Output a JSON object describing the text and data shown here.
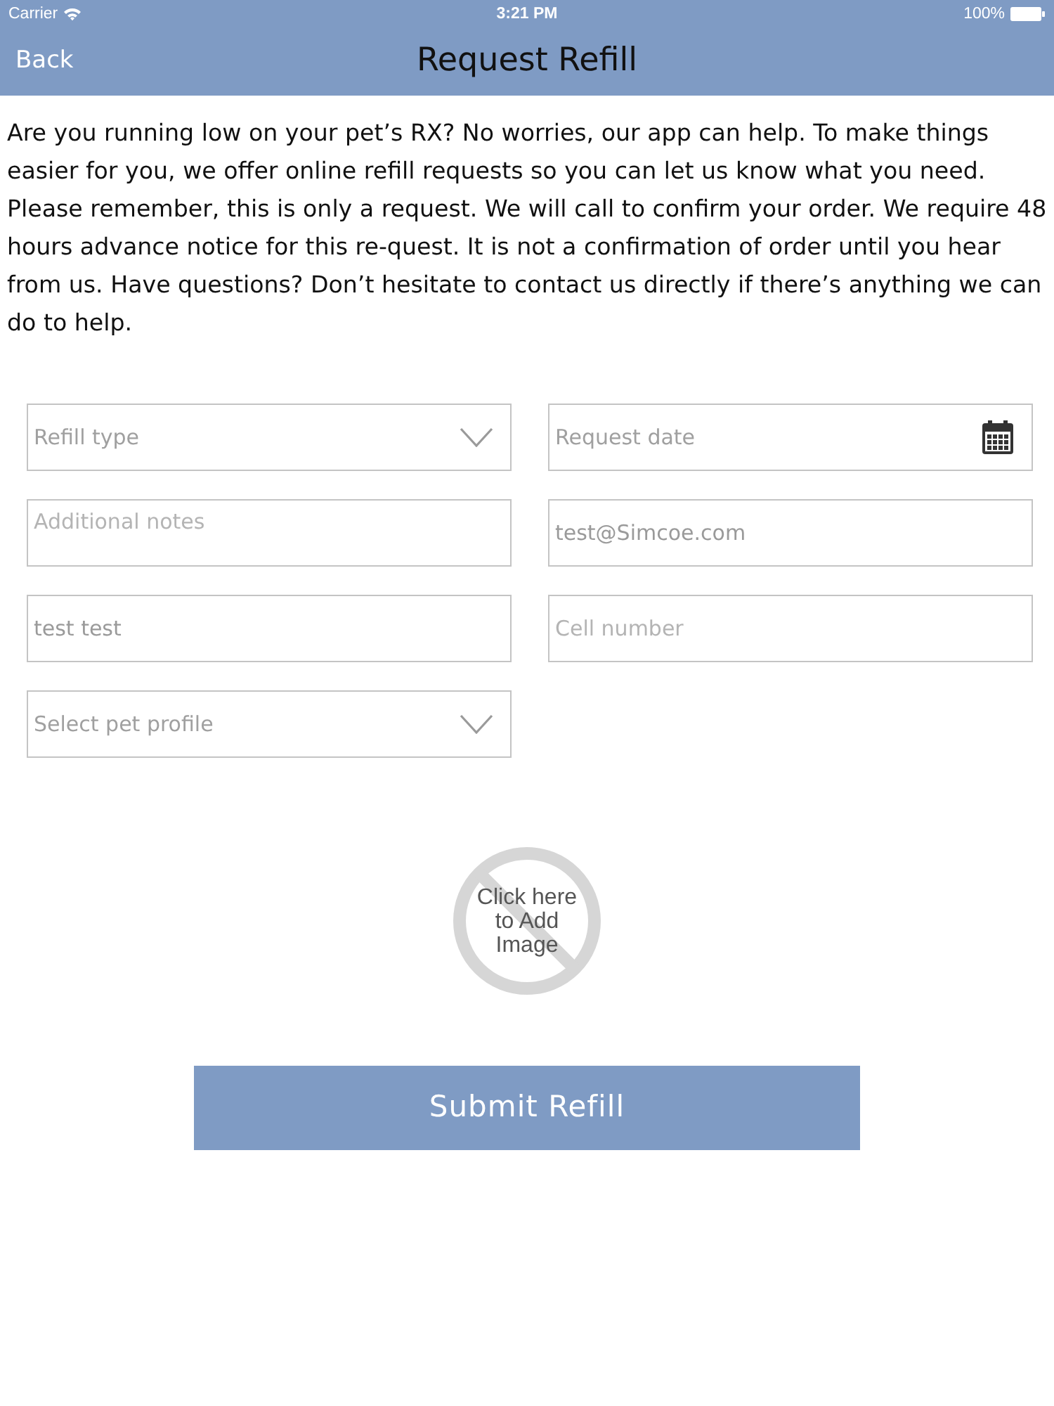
{
  "status_bar": {
    "carrier": "Carrier",
    "time": "3:21 PM",
    "battery": "100%"
  },
  "nav": {
    "back": "Back",
    "title": "Request Refill"
  },
  "intro": "Are you running low on your pet’s RX? No worries, our app can help. To make things easier for you, we offer online refill requests so you can let us know what you need. Please remember, this is only a request. We will call to confirm your order. We require 48 hours advance notice for this re-quest. It is not a confirmation of order until you hear from us. Have questions? Don’t hesitate to contact us directly if there’s anything we can do to help.",
  "fields": [
    {
      "kind": "select",
      "placeholder": "Refill type"
    },
    {
      "kind": "date",
      "placeholder": "Request date"
    },
    {
      "kind": "textarea",
      "placeholder": "Additional notes"
    },
    {
      "kind": "text",
      "value": "test@Simcoe.com"
    },
    {
      "kind": "text",
      "value": "test test"
    },
    {
      "kind": "text",
      "placeholder": "Cell number"
    },
    {
      "kind": "select",
      "placeholder": "Select pet profile"
    }
  ],
  "image_picker": {
    "label": "Click here to Add Image"
  },
  "submit": "Submit Refill"
}
